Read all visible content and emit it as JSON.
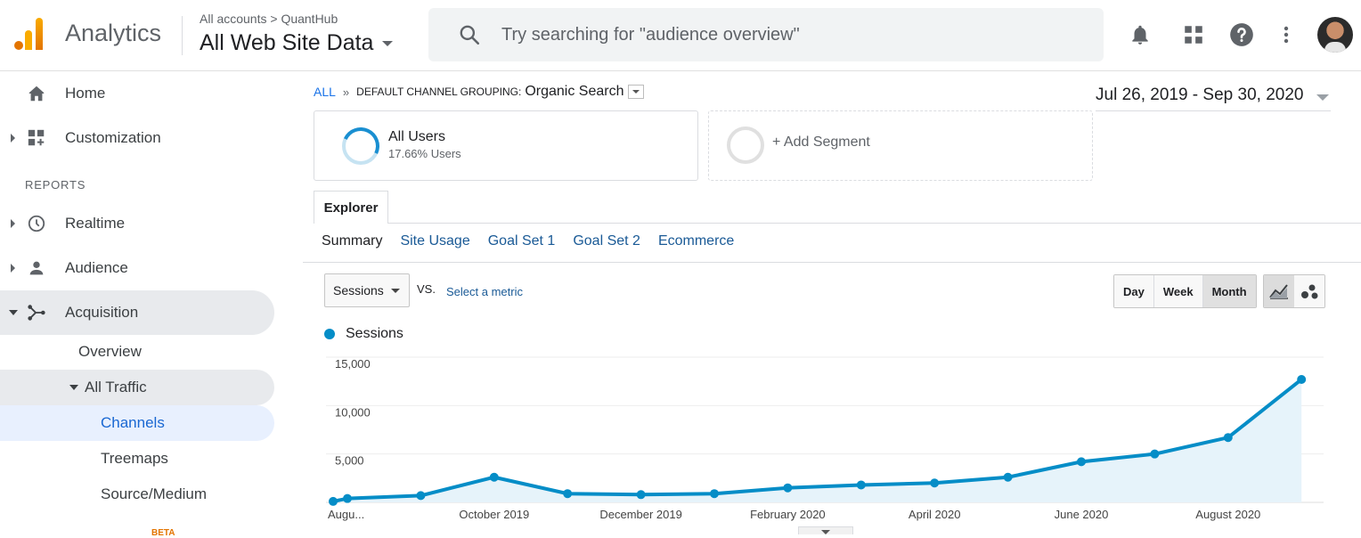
{
  "header": {
    "app_name": "Analytics",
    "breadcrumb": "All accounts > QuantHub",
    "property": "All Web Site Data",
    "search_placeholder": "Try searching for \"audience overview\"",
    "icons": [
      "bell-icon",
      "apps-grid-icon",
      "help-icon",
      "more-vert-icon"
    ]
  },
  "sidebar": {
    "home": "Home",
    "customization": "Customization",
    "reports_label": "REPORTS",
    "realtime": "Realtime",
    "audience": "Audience",
    "acquisition": "Acquisition",
    "overview": "Overview",
    "all_traffic": "All Traffic",
    "channels": "Channels",
    "treemaps": "Treemaps",
    "source_medium": "Source/Medium",
    "beta_badge": "BETA"
  },
  "main": {
    "scope_all": "ALL",
    "scope_sep": "»",
    "grouping": "DEFAULT CHANNEL GROUPING:",
    "grouping_value": "Organic Search",
    "date_range": "Jul 26, 2019 - Sep 30, 2020",
    "segment_name": "All Users",
    "segment_pct": "17.66% Users",
    "add_segment": "+ Add Segment",
    "explorer_tab": "Explorer",
    "tabs": [
      "Summary",
      "Site Usage",
      "Goal Set 1",
      "Goal Set 2",
      "Ecommerce"
    ],
    "metric": "Sessions",
    "vs": "VS.",
    "select_metric": "Select a metric",
    "period_buttons": [
      "Day",
      "Week",
      "Month"
    ],
    "active_period": "Month"
  },
  "chart_data": {
    "type": "area",
    "series": [
      {
        "name": "Sessions",
        "color": "#058dc7",
        "x": [
          "2019-07-26",
          "2019-08",
          "2019-09",
          "2019-10",
          "2019-11",
          "2019-12",
          "2020-01",
          "2020-02",
          "2020-03",
          "2020-04",
          "2020-05",
          "2020-06",
          "2020-07",
          "2020-08",
          "2020-09"
        ],
        "values": [
          100,
          400,
          700,
          2600,
          900,
          800,
          900,
          1500,
          1800,
          2000,
          2600,
          4200,
          5000,
          6700,
          12700
        ]
      }
    ],
    "yticks": [
      "15,000",
      "10,000",
      "5,000"
    ],
    "ytick_values": [
      15000,
      10000,
      5000
    ],
    "xticks": [
      "Augu...",
      "October 2019",
      "December 2019",
      "February 2020",
      "April 2020",
      "June 2020",
      "August 2020"
    ],
    "ylim": [
      0,
      15000
    ],
    "legend": "Sessions",
    "grid": true
  }
}
